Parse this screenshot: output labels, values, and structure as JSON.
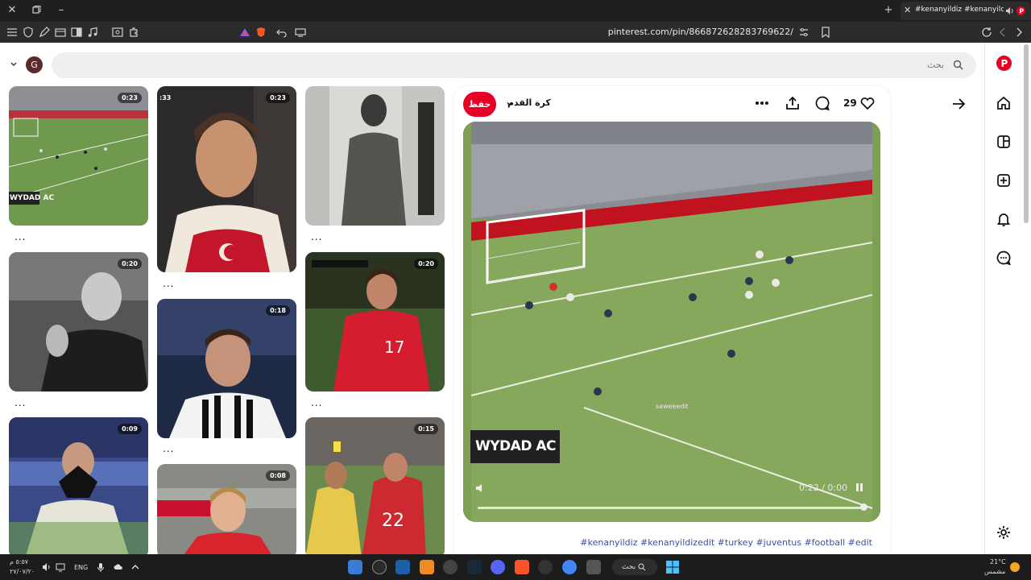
{
  "window": {
    "tab_title": "#kenanyildiz #kenanyildizedit",
    "controls": [
      "close",
      "restore",
      "minimize"
    ]
  },
  "toolbar": {
    "url": "pinterest.com/pin/866872628283769622/"
  },
  "header": {
    "avatar_letter": "G",
    "search_placeholder": "بحث"
  },
  "grid": {
    "thumbnails": [
      {
        "duration": "0:23",
        "more": "..."
      },
      {
        "duration": "0:20",
        "more": "..."
      },
      {
        "duration": "0:09",
        "more": ""
      },
      {
        "duration": "0:23",
        "more": "...",
        "corner_label": ":33"
      },
      {
        "duration": "0:18",
        "more": "..."
      },
      {
        "duration": "0:08",
        "more": ""
      },
      {
        "duration": "",
        "more": "..."
      },
      {
        "duration": "0:20",
        "more": "..."
      },
      {
        "duration": "0:15",
        "more": ""
      }
    ],
    "overlay_texts": {
      "wydad_small": "WYDAD AC"
    }
  },
  "pin": {
    "save_label": "حفظ",
    "board_name": "كرة القدم",
    "likes_count": "29",
    "video_time": "0:22 / 0:00",
    "overlay_text": "WYDAD AC",
    "watermark": "saweeedit",
    "progress": 0.99,
    "hashtags": "#kenanyildiz #kenanyildizedit #turkey #juventus #football #edit"
  },
  "nav": {
    "items": [
      "back-arrow",
      "home",
      "boards",
      "create",
      "notifications",
      "messages",
      "settings"
    ]
  },
  "taskbar": {
    "time": "٥:٥٧",
    "date": "٢٧/٠٧/٢٠",
    "ampm": "م",
    "language": "ENG",
    "search_label": "بحث",
    "temperature": "21°C",
    "weather": "مشمس"
  },
  "colors": {
    "pinterest_red": "#e60023",
    "hashtag_blue": "#3b4fa8",
    "titlebar": "#1f1f1f",
    "toolbar": "#2b2b2b",
    "taskbar": "#1c1c1c"
  }
}
